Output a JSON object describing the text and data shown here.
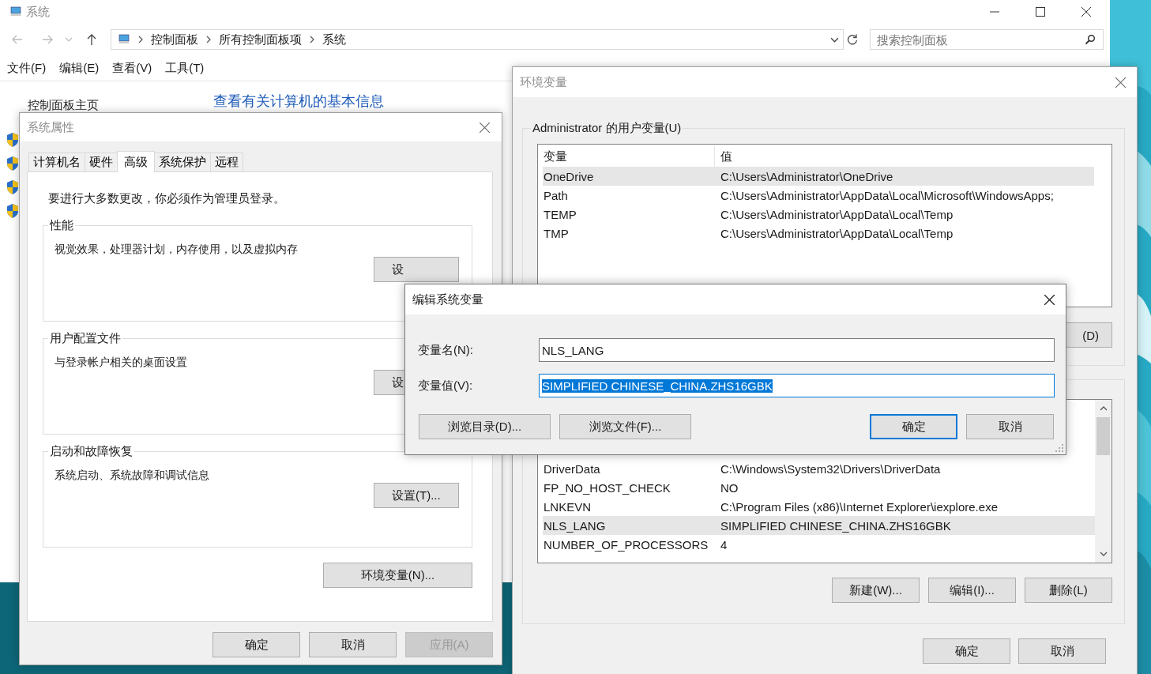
{
  "explorer": {
    "title": "系统",
    "breadcrumbs": [
      "控制面板",
      "所有控制面板项",
      "系统"
    ],
    "search": {
      "placeholder": "搜索控制面板"
    },
    "menu": [
      "文件(F)",
      "编辑(E)",
      "查看(V)",
      "工具(T)"
    ],
    "sidebar_link": "控制面板主页",
    "heading": "查看有关计算机的基本信息"
  },
  "system_properties": {
    "title": "系统属性",
    "tabs": [
      {
        "label": "计算机名",
        "selected": false
      },
      {
        "label": "硬件",
        "selected": false
      },
      {
        "label": "高级",
        "selected": true
      },
      {
        "label": "系统保护",
        "selected": false
      },
      {
        "label": "远程",
        "selected": false
      }
    ],
    "notice": "要进行大多数更改，你必须作为管理员登录。",
    "groups": [
      {
        "title": "性能",
        "description": "视觉效果，处理器计划，内存使用，以及虚拟内存",
        "button": "设"
      },
      {
        "title": "用户配置文件",
        "description": "与登录帐户相关的桌面设置",
        "button": "设"
      },
      {
        "title": "启动和故障恢复",
        "description": "系统启动、系统故障和调试信息",
        "button": "设置(T)..."
      }
    ],
    "env_button": "环境变量(N)...",
    "buttons": [
      {
        "label": "确定",
        "disabled": false
      },
      {
        "label": "取消",
        "disabled": false
      },
      {
        "label": "应用(A)",
        "disabled": true
      }
    ]
  },
  "environment": {
    "title": "环境变量",
    "user_group": "Administrator 的用户变量(U)",
    "columns": [
      "变量",
      "值"
    ],
    "user_rows": [
      {
        "name": "OneDrive",
        "value": "C:\\Users\\Administrator\\OneDrive",
        "selected": true
      },
      {
        "name": "Path",
        "value": "C:\\Users\\Administrator\\AppData\\Local\\Microsoft\\WindowsApps;",
        "selected": false
      },
      {
        "name": "TEMP",
        "value": "C:\\Users\\Administrator\\AppData\\Local\\Temp",
        "selected": false
      },
      {
        "name": "TMP",
        "value": "C:\\Users\\Administrator\\AppData\\Local\\Temp",
        "selected": false
      }
    ],
    "user_button": "(D)",
    "system_rows": [
      {
        "name": "DriverData",
        "value": "C:\\Windows\\System32\\Drivers\\DriverData",
        "selected": false
      },
      {
        "name": "FP_NO_HOST_CHECK",
        "value": "NO",
        "selected": false
      },
      {
        "name": "LNKEVN",
        "value": "C:\\Program Files (x86)\\Internet Explorer\\iexplore.exe",
        "selected": false
      },
      {
        "name": "NLS_LANG",
        "value": "SIMPLIFIED CHINESE_CHINA.ZHS16GBK",
        "selected": true
      },
      {
        "name": "NUMBER_OF_PROCESSORS",
        "value": "4",
        "selected": false
      }
    ],
    "system_buttons": [
      "新建(W)...",
      "编辑(I)...",
      "删除(L)"
    ],
    "buttons": [
      "确定",
      "取消"
    ]
  },
  "edit_dialog": {
    "title": "编辑系统变量",
    "fields": [
      {
        "label": "变量名(N):",
        "value": "NLS_LANG",
        "selected": false
      },
      {
        "label": "变量值(V):",
        "value": "SIMPLIFIED CHINESE_CHINA.ZHS16GBK",
        "selected": true
      }
    ],
    "buttons": [
      {
        "label": "浏览目录(D)...",
        "default": false
      },
      {
        "label": "浏览文件(F)...",
        "default": false
      },
      {
        "label": "确定",
        "default": true
      },
      {
        "label": "取消",
        "default": false
      }
    ]
  }
}
